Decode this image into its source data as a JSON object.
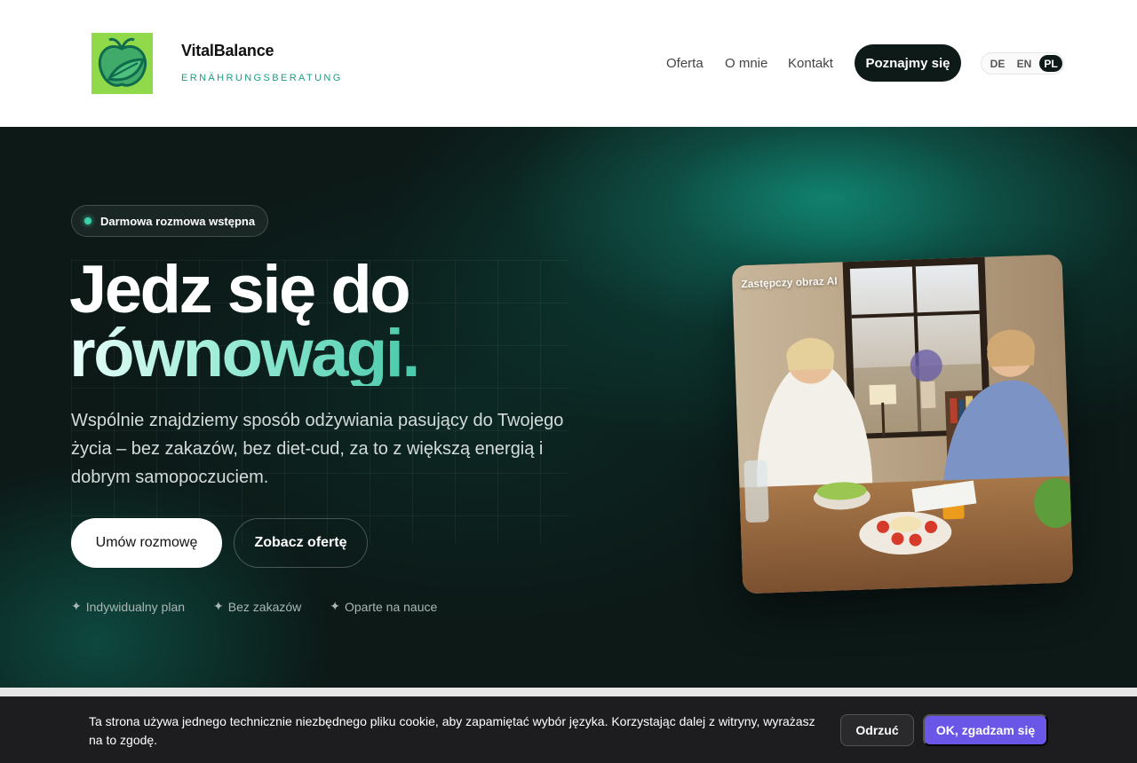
{
  "header": {
    "brand_name": "VitalBalance",
    "brand_sub": "ERNÄHRUNGSBERATUNG",
    "nav": [
      "Oferta",
      "O mnie",
      "Kontakt"
    ],
    "cta": "Poznajmy się",
    "languages": [
      "DE",
      "EN",
      "PL"
    ],
    "active_language": "PL"
  },
  "hero": {
    "badge": "Darmowa rozmowa wstępna",
    "headline_line1": "Jedz się do",
    "headline_line2": "równowagi.",
    "description": "Wspólnie znajdziemy sposób odżywiania pasujący do Twojego życia – bez zakazów, bez diet-cud, za to z większą energią i dobrym samopoczuciem.",
    "primary_button": "Umów rozmowę",
    "secondary_button": "Zobacz ofertę",
    "features": [
      "Indywidualny plan",
      "Bez zakazów",
      "Oparte na nauce"
    ],
    "feature_icon": "sparkle-icon",
    "image_label": "Zastępczy obraz AI"
  },
  "cookie": {
    "text": "Ta strona używa jednego technicznie niezbędnego pliku cookie, aby zapamiętać wybór języka. Korzystając dalej z witryny, wyrażasz na to zgodę.",
    "reject": "Odrzuć",
    "accept": "OK, zgadzam się"
  },
  "colors": {
    "accent": "#1b9c85",
    "hero_bg": "#0c1917",
    "accept_button": "#6a57e8"
  }
}
